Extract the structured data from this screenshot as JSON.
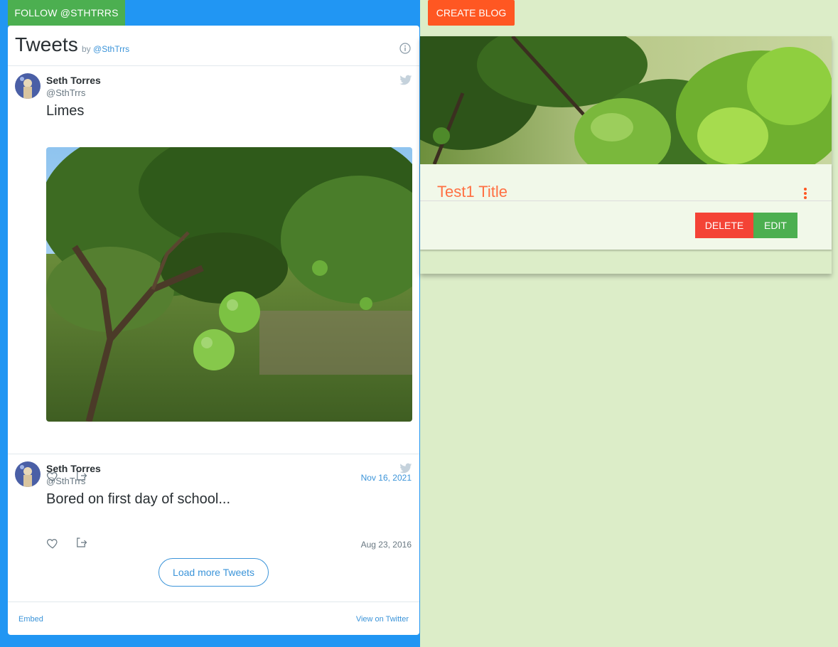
{
  "follow_button": "FOLLOW @STHTRRS",
  "create_blog_button": "CREATE BLOG",
  "timeline": {
    "title": "Tweets",
    "by_prefix": "by",
    "by_handle": "@SthTrrs",
    "load_more": "Load more Tweets",
    "embed": "Embed",
    "view_on_twitter": "View on Twitter"
  },
  "tweets": [
    {
      "name": "Seth Torres",
      "handle": "@SthTrrs",
      "text": "Limes",
      "date": "Nov 16, 2021"
    },
    {
      "name": "Seth Torres",
      "handle": "@SthTrrs",
      "text": "Bored on first day of school...",
      "date": "Aug 23, 2016"
    }
  ],
  "blog": {
    "title": "Test1 Title",
    "delete_label": "DELETE",
    "edit_label": "EDIT"
  },
  "colors": {
    "page_bg": "#dcedc8",
    "twitter_blue": "#2196f3",
    "follow_green": "#4caf50",
    "create_orange": "#ff5722",
    "delete_red": "#f44336",
    "link_blue": "#3b94d9"
  }
}
